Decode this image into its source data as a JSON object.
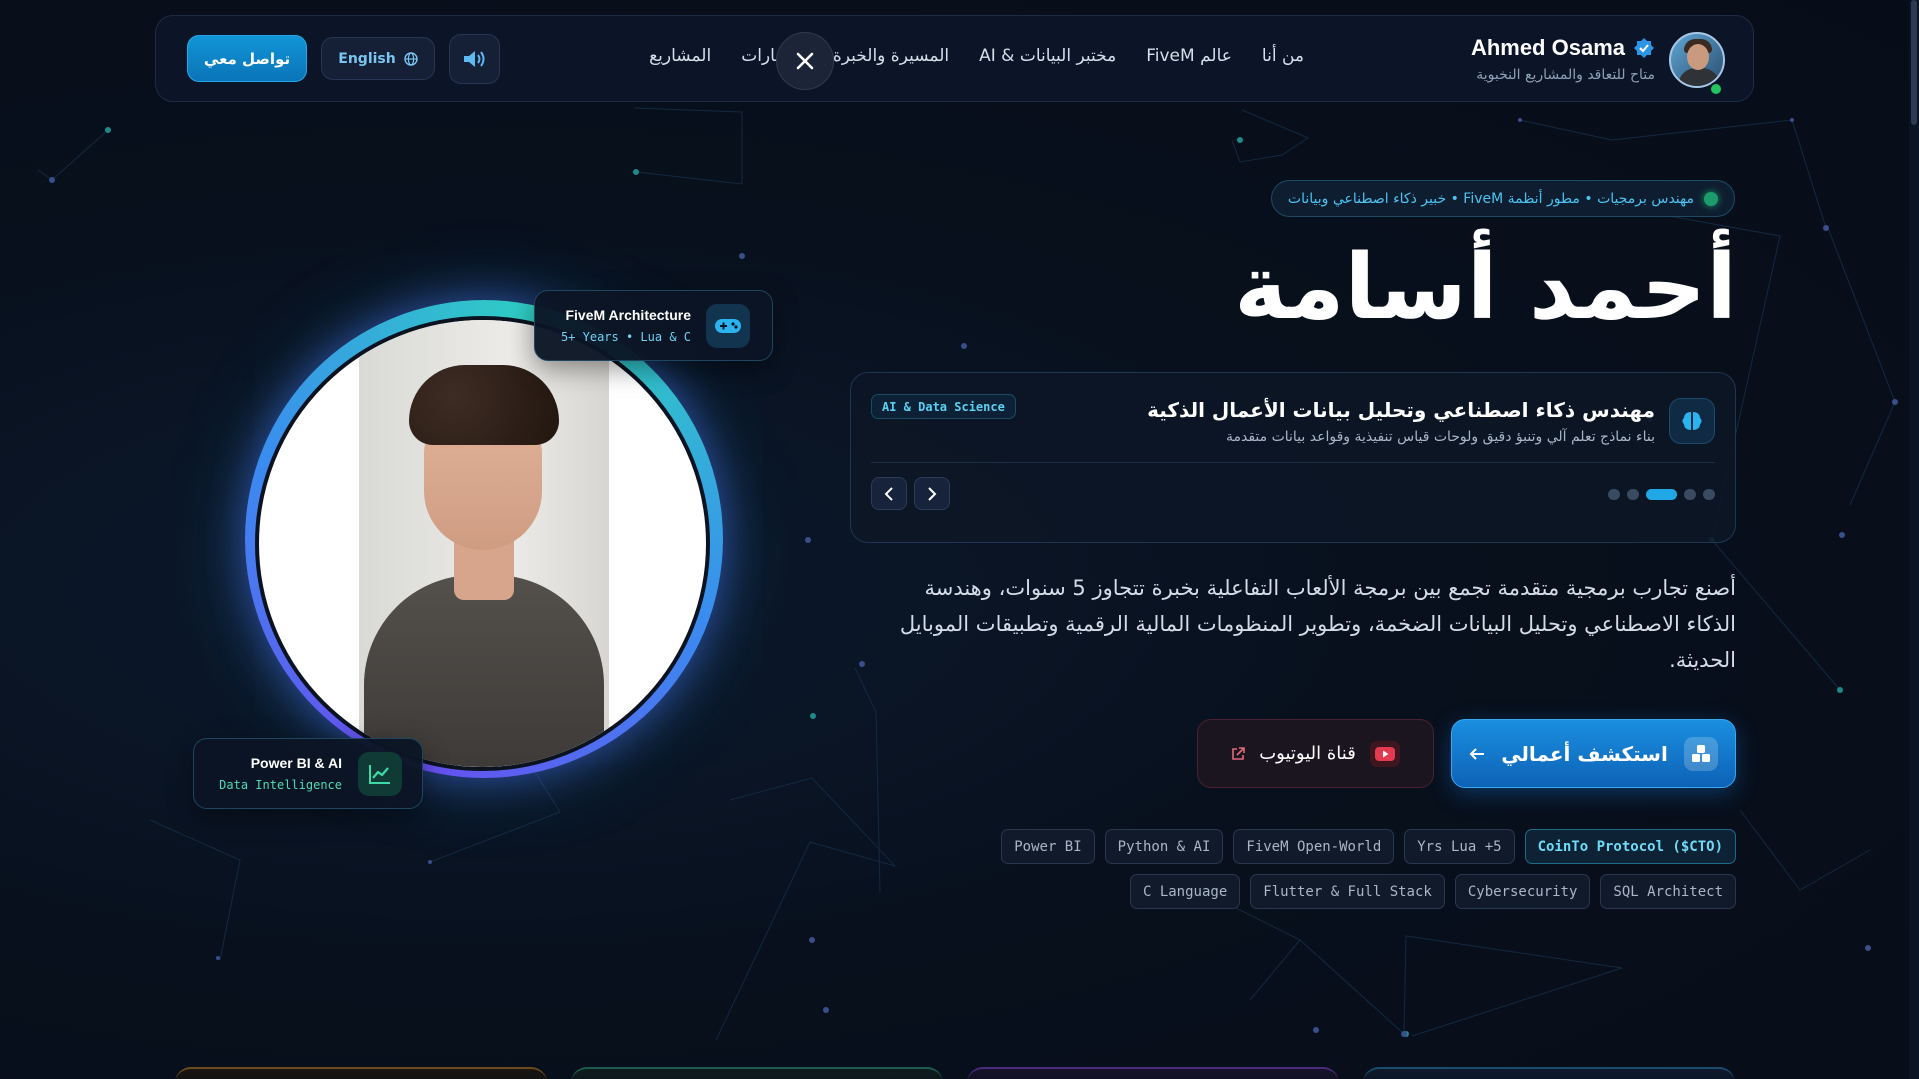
{
  "header": {
    "contact_label": "تواصل معي",
    "lang_label": "English",
    "nav_links": [
      "من أنا",
      "عالم FiveM",
      "مختبر البيانات & AI",
      "المسيرة والخبرة",
      "المهارات",
      "المشاريع"
    ],
    "brand_name": "Ahmed Osama",
    "brand_sub": "متاح للتعاقد والمشاريع النخبوية"
  },
  "hero": {
    "roles_badge": "مهندس برمجيات • مطور أنظمة FiveM • خبير ذكاء اصطناعي وبيانات",
    "name": "أحمد أسامة",
    "slider": {
      "title": "مهندس ذكاء اصطناعي وتحليل بيانات الأعمال الذكية",
      "subtitle": "بناء نماذج تعلم آلي وتنبؤ دقيق ولوحات قياس تنفيذية وقواعد بيانات متقدمة",
      "tag": "AI & Data Science",
      "active_dot_index": 2,
      "dot_count": 5
    },
    "description": "أصنع تجارب برمجية متقدمة تجمع بين برمجة الألعاب التفاعلية بخبرة تتجاوز 5 سنوات، وهندسة الذكاء الاصطناعي وتحليل البيانات الضخمة، وتطوير المنظومات المالية الرقمية وتطبيقات الموبايل الحديثة.",
    "explore_label": "استكشف أعمالي",
    "youtube_label": "قناة اليوتيوب",
    "chips": [
      "CoinTo Protocol ($CTO)",
      "5+ Yrs Lua",
      "FiveM Open-World",
      "Python & AI",
      "Power BI",
      "SQL Architect",
      "Cybersecurity",
      "Flutter & Full Stack",
      "C Language"
    ],
    "highlight_chip": "CoinTo Protocol ($CTO)"
  },
  "floating_cards": {
    "fivem": {
      "title": "FiveM Architecture",
      "sub": "5+ Years • Lua & C"
    },
    "powerbi": {
      "title": "Power BI & AI",
      "sub": "Data Intelligence"
    }
  },
  "colors": {
    "accent": "#20a8e6",
    "background": "#080f1c",
    "online": "#22c55e",
    "youtube": "#e23b4f"
  }
}
